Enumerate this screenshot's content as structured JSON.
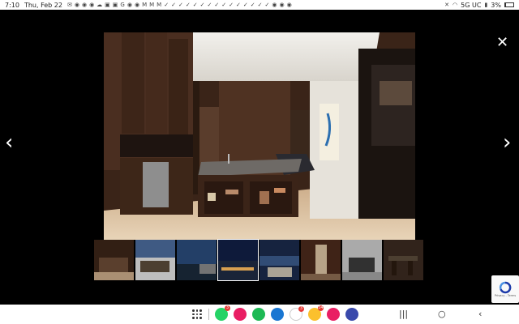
{
  "status_bar": {
    "time": "7:10",
    "date": "Thu, Feb 22",
    "notification_icons": [
      "mail-icon",
      "whatsapp-icon",
      "skype-icon",
      "message-icon",
      "cloud-icon",
      "app-icon",
      "app-icon",
      "google-icon",
      "pinterest-icon",
      "app-icon",
      "gmail-icon",
      "gmail-icon",
      "gmail-icon",
      "check-icon",
      "check-icon",
      "check-icon",
      "check-icon",
      "check-icon",
      "check-icon",
      "check-icon",
      "check-icon",
      "check-icon",
      "check-icon",
      "check-icon",
      "check-icon",
      "check-icon",
      "check-icon",
      "check-icon",
      "chrome-icon",
      "app-icon",
      "app-icon"
    ],
    "network": "5G UC",
    "battery": "3%"
  },
  "viewer": {
    "close_glyph": "✕",
    "prev_glyph": "‹",
    "next_glyph": "›",
    "active_thumbnail_index": 3,
    "thumbnail_count": 8
  },
  "recaptcha": {
    "text": "Privacy - Terms"
  },
  "nav_bar": {
    "dock_apps": [
      {
        "name": "whatsapp",
        "color": "#25d366",
        "badge": "3"
      },
      {
        "name": "phone-app",
        "color": "#e91e63",
        "badge": ""
      },
      {
        "name": "green-app",
        "color": "#1db954",
        "badge": ""
      },
      {
        "name": "messages",
        "color": "#1976d2",
        "badge": ""
      },
      {
        "name": "gmail",
        "color": "#ffffff",
        "badge": "3"
      },
      {
        "name": "chrome",
        "color": "#fbc02d",
        "badge": "34"
      },
      {
        "name": "flower-app",
        "color": "#e91e63",
        "badge": ""
      },
      {
        "name": "settings",
        "color": "#3949ab",
        "badge": ""
      }
    ],
    "recents_glyph": "|||",
    "home_glyph": "○",
    "back_glyph": "‹"
  }
}
